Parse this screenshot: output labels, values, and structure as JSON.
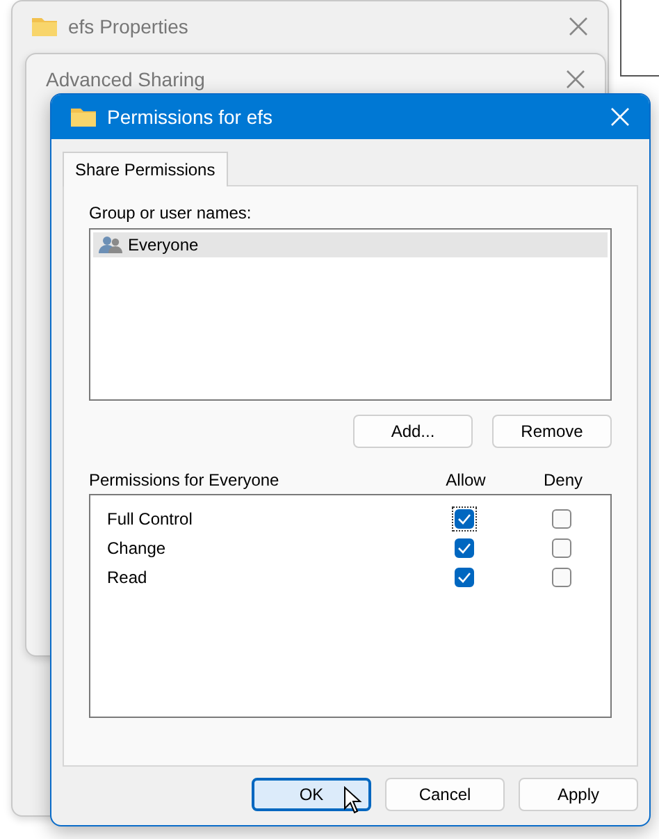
{
  "background_windows": [
    {
      "title": "efs Properties"
    },
    {
      "title": "Advanced Sharing"
    }
  ],
  "dialog": {
    "title": "Permissions for efs"
  },
  "tabs": [
    {
      "label": "Share Permissions",
      "selected": true
    }
  ],
  "group_label": "Group or user names:",
  "users": [
    {
      "name": "Everyone",
      "selected": true
    }
  ],
  "user_buttons": [
    "Add...",
    "Remove"
  ],
  "permissions_header": {
    "label": "Permissions for Everyone",
    "allow": "Allow",
    "deny": "Deny"
  },
  "permissions": [
    {
      "name": "Full Control",
      "allow": true,
      "deny": false,
      "focused": true
    },
    {
      "name": "Change",
      "allow": true,
      "deny": false,
      "focused": false
    },
    {
      "name": "Read",
      "allow": true,
      "deny": false,
      "focused": false
    }
  ],
  "footer_buttons": [
    {
      "label": "OK",
      "default": true
    },
    {
      "label": "Cancel",
      "default": false
    },
    {
      "label": "Apply",
      "default": false
    }
  ]
}
